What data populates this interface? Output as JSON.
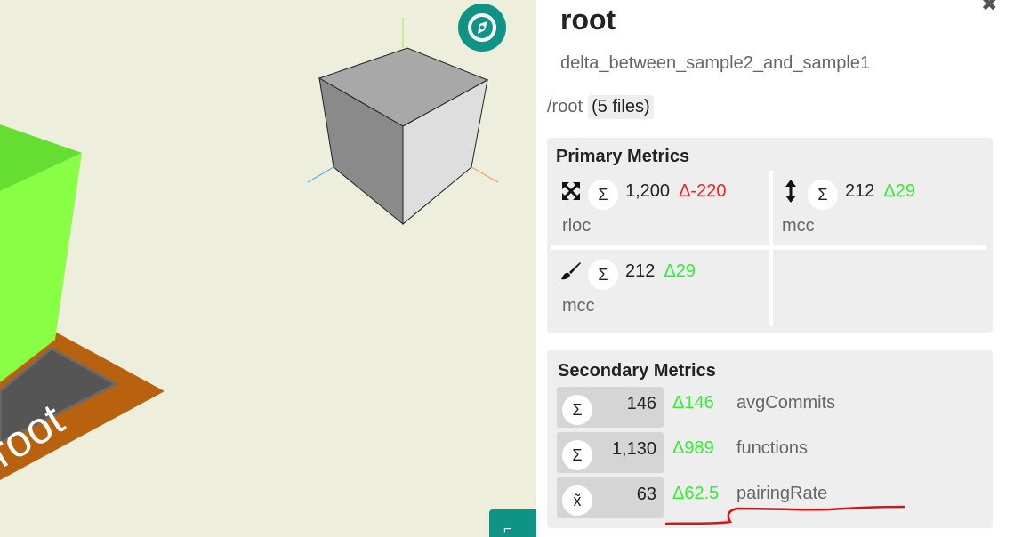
{
  "scene": {
    "floor_label": "root",
    "colors": {
      "background": "#eeeedd",
      "building": "#88ff44",
      "floor": "#b8620f",
      "slab": "#555555",
      "cube_top": "#a8a8a8",
      "cube_left": "#8a8a8a",
      "cube_right": "#dedede",
      "accent": "#0f9384"
    },
    "compass_icon": "compass-icon"
  },
  "panel": {
    "title": "root",
    "map_name": "delta_between_sample2_and_sample1",
    "path": "/root",
    "file_count": "(5 files)",
    "close_icon": "close-icon",
    "primary": {
      "heading": "Primary Metrics",
      "metrics": [
        {
          "icon": "expand-arrows-icon",
          "aggregation": "Σ",
          "value": "1,200",
          "delta": "Δ-220",
          "delta_sign": "negative",
          "name": "rloc"
        },
        {
          "icon": "vertical-arrows-icon",
          "aggregation": "Σ",
          "value": "212",
          "delta": "Δ29",
          "delta_sign": "positive",
          "name": "mcc"
        },
        {
          "icon": "paint-brush-icon",
          "aggregation": "Σ",
          "value": "212",
          "delta": "Δ29",
          "delta_sign": "positive",
          "name": "mcc"
        }
      ]
    },
    "secondary": {
      "heading": "Secondary Metrics",
      "rows": [
        {
          "aggregation": "Σ",
          "value": "146",
          "delta": "Δ146",
          "name": "avgCommits"
        },
        {
          "aggregation": "Σ",
          "value": "1,130",
          "delta": "Δ989",
          "name": "functions"
        },
        {
          "aggregation": "x̃",
          "value": "63",
          "delta": "Δ62.5",
          "name": "pairingRate"
        }
      ]
    }
  }
}
